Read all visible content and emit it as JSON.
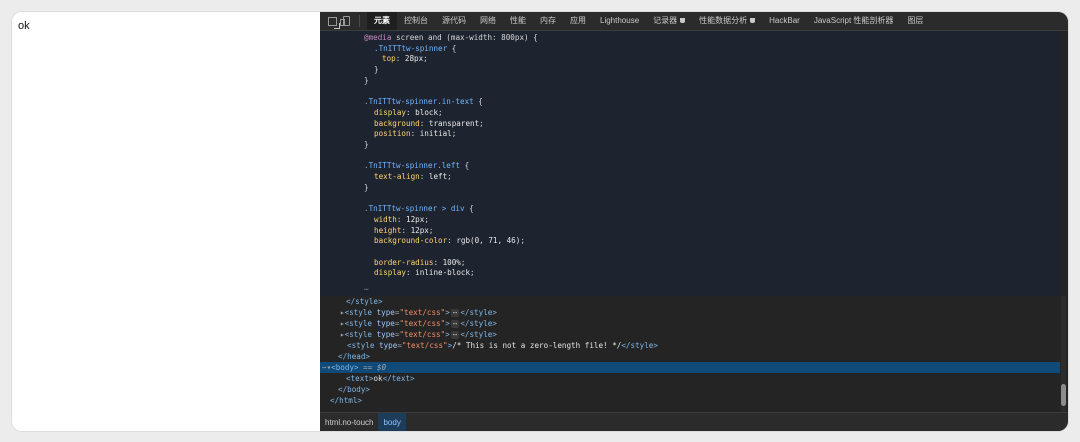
{
  "page": {
    "text": "ok"
  },
  "devtools": {
    "tabs": [
      {
        "label": "元素"
      },
      {
        "label": "控制台"
      },
      {
        "label": "源代码"
      },
      {
        "label": "网络"
      },
      {
        "label": "性能"
      },
      {
        "label": "内存"
      },
      {
        "label": "应用"
      },
      {
        "label": "Lighthouse"
      },
      {
        "label": "记录器"
      },
      {
        "label": "性能数据分析"
      },
      {
        "label": "HackBar"
      },
      {
        "label": "JavaScript 性能剖析器"
      },
      {
        "label": "图层"
      }
    ],
    "styles": {
      "l1_at": "@media",
      "l1_rest": " screen and (max-width: 800px) {",
      "l2_sel": ".TnITTtw-spinner",
      "l2_rest": " {",
      "l3_prop": "top",
      "l3_val": "28px",
      "close": "}",
      "l6_sel": ".TnITTtw-spinner.in-text",
      "l6_rest": " {",
      "l7_prop": "display",
      "l7_val": "block",
      "l8_prop": "background",
      "l8_val": "transparent",
      "l9_prop": "position",
      "l9_val": "initial",
      "l12_sel": ".TnITTtw-spinner.left",
      "l12_rest": " {",
      "l13_prop": "text-align",
      "l13_val": "left",
      "l16_sel": ".TnITTtw-spinner > div",
      "l16_rest": " {",
      "l17_prop": "width",
      "l17_val": "12px",
      "l18_prop": "height",
      "l18_val": "12px",
      "l19_prop": "background-color",
      "l19_val": "rgb(0, 71, 46)",
      "l21_prop": "border-radius",
      "l21_val": "100%",
      "l22_prop": "display",
      "l22_val": "inline-block",
      "ellipsis": "…"
    },
    "dom": {
      "style_close": "</style>",
      "style_open_tag": "<style ",
      "style_attr": "type",
      "style_attrval": "\"text/css\"",
      "style_gt": ">",
      "dots": "⋯",
      "style_end": "</style>",
      "comment_text": "/* This is not a zero-length file! */",
      "head_close": "</head>",
      "body_open": "<body>",
      "body_eq": "==",
      "body_dollar": "$0",
      "text_open": "<text>",
      "text_content": "ok",
      "text_close": "</text>",
      "body_close": "</body>",
      "html_close": "</html>"
    },
    "breadcrumbs": [
      {
        "label": "html.no-touch"
      },
      {
        "label": "body"
      }
    ]
  }
}
